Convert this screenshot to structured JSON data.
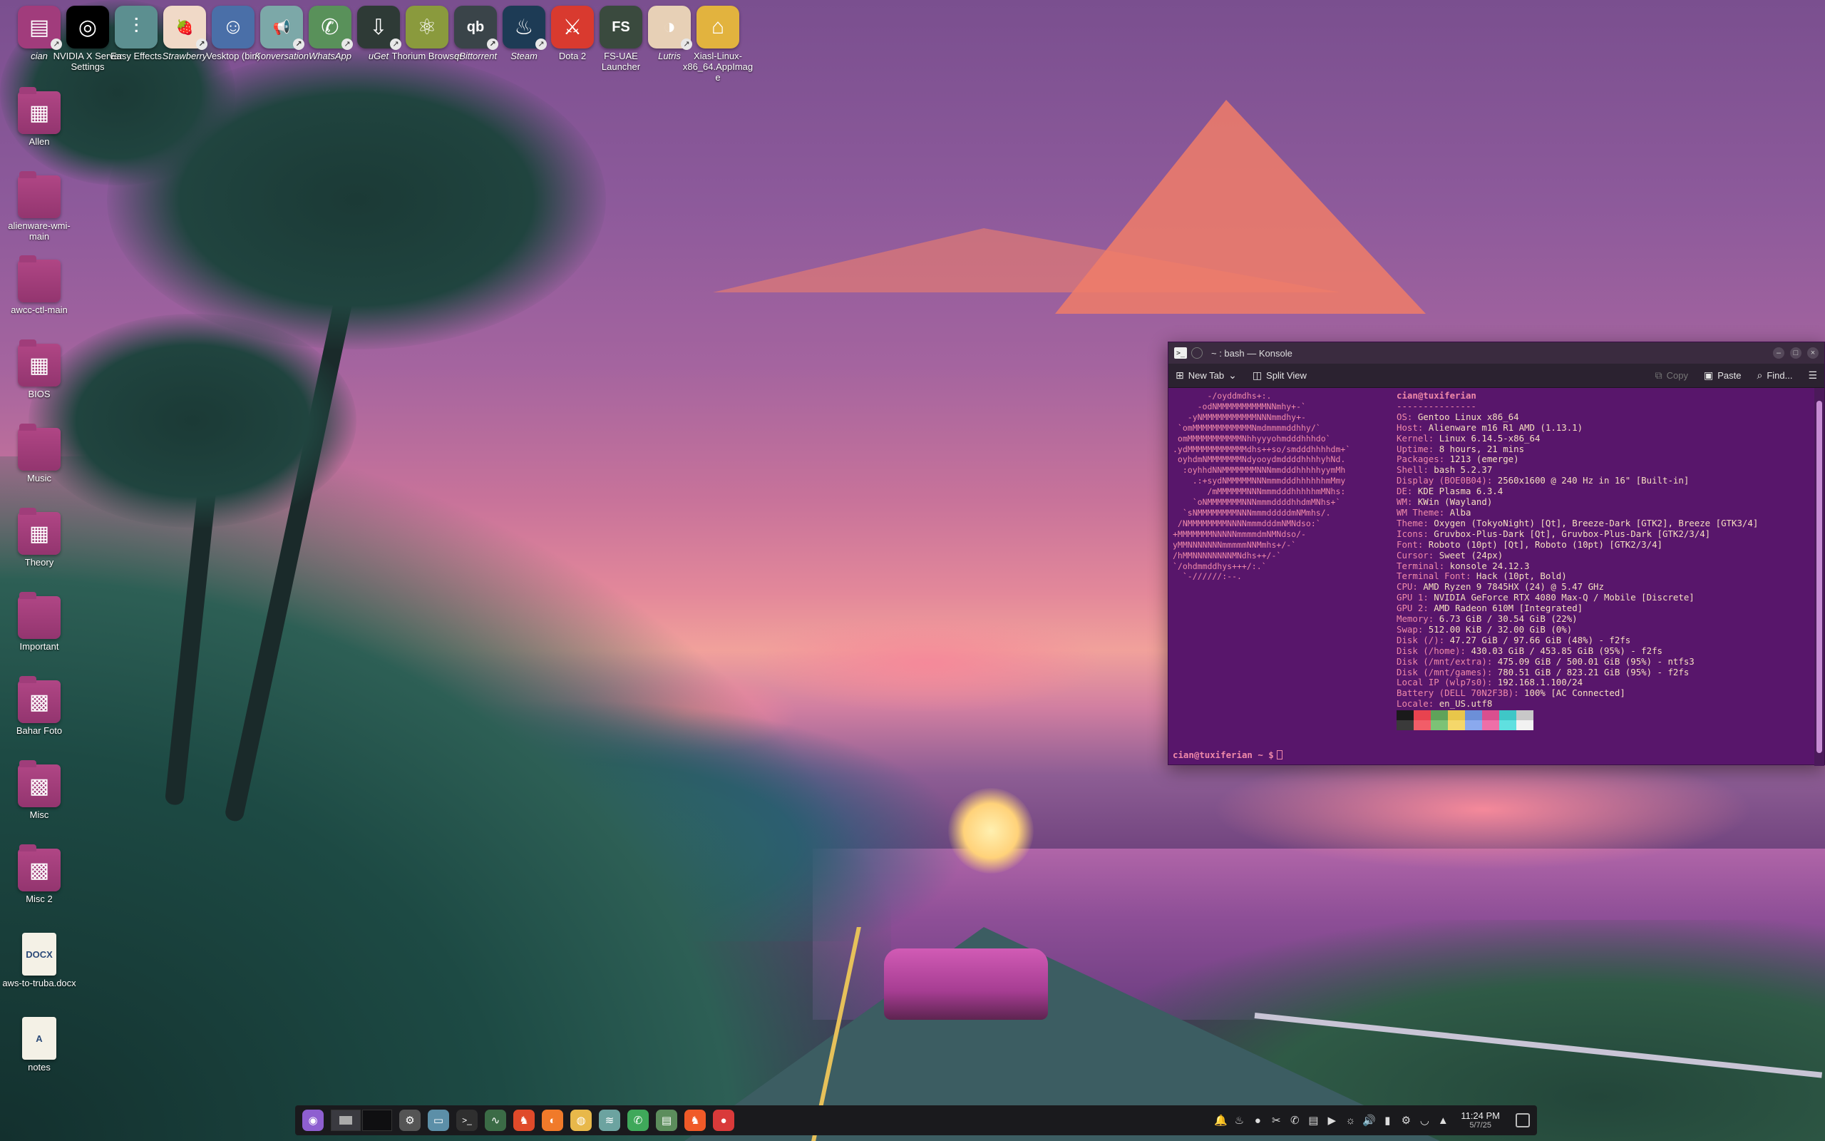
{
  "colors": {
    "folder": "#a13c7c",
    "terminal_bg": "#58166b",
    "terminal_pink": "#f08aa9",
    "terminal_cream": "#f7e0c0",
    "taskbar_bg": "#1a1a1d"
  },
  "desktop_top_icons": [
    {
      "label": "cian",
      "icon": "folder-user-icon",
      "glyph": "▤",
      "bg": "#a13c7c",
      "link": true,
      "italic": true
    },
    {
      "label": "NVIDIA X Server Settings",
      "icon": "nvidia-icon",
      "glyph": "◎",
      "bg": "#000000",
      "link": false,
      "italic": false
    },
    {
      "label": "Easy Effects",
      "icon": "equalizer-icon",
      "glyph": "⫶",
      "bg": "#5c8f90",
      "link": false,
      "italic": false
    },
    {
      "label": "Strawberry",
      "icon": "strawberry-icon",
      "glyph": "🍓",
      "bg": "#f0d9c7",
      "link": true,
      "italic": true
    },
    {
      "label": "Vesktop (bin)",
      "icon": "discord-icon",
      "glyph": "☺",
      "bg": "#4a6fa8",
      "link": false,
      "italic": false
    },
    {
      "label": "Konversation",
      "icon": "megaphone-icon",
      "glyph": "📢",
      "bg": "#7ca8a8",
      "link": true,
      "italic": true
    },
    {
      "label": "WhatsApp",
      "icon": "whatsapp-icon",
      "glyph": "✆",
      "bg": "#59915a",
      "link": true,
      "italic": true
    },
    {
      "label": "uGet",
      "icon": "uget-icon",
      "glyph": "⇩",
      "bg": "#2e3a36",
      "link": true,
      "italic": true
    },
    {
      "label": "Thorium Browser",
      "icon": "thorium-icon",
      "glyph": "⚛",
      "bg": "#8a9a3d",
      "link": false,
      "italic": false
    },
    {
      "label": "qBittorrent",
      "icon": "qbittorrent-icon",
      "glyph": "qb",
      "bg": "#3a4449",
      "link": true,
      "italic": true
    },
    {
      "label": "Steam",
      "icon": "steam-icon",
      "glyph": "♨",
      "bg": "#1d3b55",
      "link": true,
      "italic": true
    },
    {
      "label": "Dota 2",
      "icon": "dota2-icon",
      "glyph": "⚔",
      "bg": "#d93a2f",
      "link": false,
      "italic": false
    },
    {
      "label": "FS-UAE Launcher",
      "icon": "fsuae-icon",
      "glyph": "FS",
      "bg": "#3a4a3e",
      "link": false,
      "italic": false
    },
    {
      "label": "Lutris",
      "icon": "lutris-icon",
      "glyph": "◑",
      "bg": "#e7d0b6",
      "link": true,
      "italic": true
    },
    {
      "label": "Xiasl-Linux-x86_64.AppImage",
      "icon": "appimage-icon",
      "glyph": "⌂",
      "bg": "#e2b33e",
      "link": false,
      "italic": false
    }
  ],
  "desktop_left_icons": [
    {
      "label": "Allen",
      "icon": "folder-preview-icon",
      "glyph": "▦",
      "type": "folder"
    },
    {
      "label": "alienware-wmi-main",
      "icon": "folder-icon",
      "glyph": "",
      "type": "folder"
    },
    {
      "label": "awcc-ctl-main",
      "icon": "folder-icon",
      "glyph": "",
      "type": "folder"
    },
    {
      "label": "BIOS",
      "icon": "folder-preview-icon",
      "glyph": "▦",
      "type": "folder"
    },
    {
      "label": "Music",
      "icon": "folder-icon",
      "glyph": "",
      "type": "folder"
    },
    {
      "label": "Theory",
      "icon": "folder-preview-icon",
      "glyph": "▦",
      "type": "folder"
    },
    {
      "label": "Important",
      "icon": "folder-icon",
      "glyph": "",
      "type": "folder"
    },
    {
      "label": "Bahar Foto",
      "icon": "folder-photo-icon",
      "glyph": "▩",
      "type": "folder"
    },
    {
      "label": "Misc",
      "icon": "folder-photo-icon",
      "glyph": "▩",
      "type": "folder"
    },
    {
      "label": "Misc 2",
      "icon": "folder-photo-icon",
      "glyph": "▩",
      "type": "folder"
    },
    {
      "label": "aws-to-truba.docx",
      "icon": "docx-file-icon",
      "glyph": "DOCX",
      "type": "doc"
    },
    {
      "label": "notes",
      "icon": "text-file-icon",
      "glyph": "A",
      "type": "doc"
    }
  ],
  "konsole": {
    "title": "~ : bash — Konsole",
    "toolbar": {
      "new_tab": "New Tab",
      "split_view": "Split View",
      "copy": "Copy",
      "paste": "Paste",
      "find": "Find..."
    },
    "ascii_art": "       -/oyddmdhs+:.\n     -odNMMMMMMMMMMNNmhy+-`\n   -yNMMMMMMMMMMMNNNmmdhy+-\n `omMMMMMMMMMMMMNmdmmmmddhhy/`\n omMMMMMMMMMMMNhhyyyohmdddhhhdo`\n.ydMMMMMMMMMMMMdhs++so/smdddhhhhdm+`\n oyhdmNMMMMMMMNdyooydmddddhhhhyhNd.\n  :oyhhdNNMMMMMMMNNNmmdddhhhhhyymMh\n    .:+sydNMMMMMNNNmmmdddhhhhhhmMmy\n       /mMMMMMMNNNmmmdddhhhhhmMNhs:\n    `oNMMMMMMMNNNmmmddddhhdmMNhs+`\n  `sNMMMMMMMMNNNmmmdddddmNMmhs/.\n /NMMMMMMMMNNNNmmmdddmNMNdso:`\n+MMMMMMMNNNNNmmmmdmNMNdso/-\nyMMNNNNNNNmmmmmNNMmhs+/-`\n/hMMNNNNNNNNMNdhs++/-`\n`/ohdmmddhys+++/:.`\n  `-//////:--.",
    "user_host": "cian@tuxiferian",
    "separator": "---------------",
    "info": [
      {
        "key": "OS",
        "value": "Gentoo Linux x86_64"
      },
      {
        "key": "Host",
        "value": "Alienware m16 R1 AMD (1.13.1)"
      },
      {
        "key": "Kernel",
        "value": "Linux 6.14.5-x86_64"
      },
      {
        "key": "Uptime",
        "value": "8 hours, 21 mins"
      },
      {
        "key": "Packages",
        "value": "1213 (emerge)"
      },
      {
        "key": "Shell",
        "value": "bash 5.2.37"
      },
      {
        "key": "Display (BOE0B04)",
        "value": "2560x1600 @ 240 Hz in 16\" [Built-in]"
      },
      {
        "key": "DE",
        "value": "KDE Plasma 6.3.4"
      },
      {
        "key": "WM",
        "value": "KWin (Wayland)"
      },
      {
        "key": "WM Theme",
        "value": "Alba"
      },
      {
        "key": "Theme",
        "value": "Oxygen (TokyoNight) [Qt], Breeze-Dark [GTK2], Breeze [GTK3/4]"
      },
      {
        "key": "Icons",
        "value": "Gruvbox-Plus-Dark [Qt], Gruvbox-Plus-Dark [GTK2/3/4]"
      },
      {
        "key": "Font",
        "value": "Roboto (10pt) [Qt], Roboto (10pt) [GTK2/3/4]"
      },
      {
        "key": "Cursor",
        "value": "Sweet (24px)"
      },
      {
        "key": "Terminal",
        "value": "konsole 24.12.3"
      },
      {
        "key": "Terminal Font",
        "value": "Hack (10pt, Bold)"
      },
      {
        "key": "CPU",
        "value": "AMD Ryzen 9 7845HX (24) @ 5.47 GHz"
      },
      {
        "key": "GPU 1",
        "value": "NVIDIA GeForce RTX 4080 Max-Q / Mobile [Discrete]"
      },
      {
        "key": "GPU 2",
        "value": "AMD Radeon 610M [Integrated]"
      },
      {
        "key": "Memory",
        "value": "6.73 GiB / 30.54 GiB (22%)"
      },
      {
        "key": "Swap",
        "value": "512.00 KiB / 32.00 GiB (0%)"
      },
      {
        "key": "Disk (/)",
        "value": "47.27 GiB / 97.66 GiB (48%) - f2fs"
      },
      {
        "key": "Disk (/home)",
        "value": "430.03 GiB / 453.85 GiB (95%) - f2fs"
      },
      {
        "key": "Disk (/mnt/extra)",
        "value": "475.09 GiB / 500.01 GiB (95%) - ntfs3"
      },
      {
        "key": "Disk (/mnt/games)",
        "value": "780.51 GiB / 823.21 GiB (95%) - f2fs"
      },
      {
        "key": "Local IP (wlp7s0)",
        "value": "192.168.1.100/24"
      },
      {
        "key": "Battery (DELL 70N2F3B)",
        "value": "100% [AC Connected]"
      },
      {
        "key": "Locale",
        "value": "en_US.utf8"
      }
    ],
    "palette": [
      "#1a1a1a",
      "#e8434f",
      "#5fa35a",
      "#e8c64a",
      "#6c8fd8",
      "#d94f8f",
      "#3fc7c7",
      "#c8c8c8",
      "#3a3a3a",
      "#f25d68",
      "#7cc276",
      "#f5d76a",
      "#8aa9ee",
      "#ee6fa8",
      "#5fe0e0",
      "#f2f2f2"
    ],
    "prompt": "cian@tuxiferian ~ $"
  },
  "taskbar": {
    "apps": [
      {
        "icon": "app-launcher-icon",
        "glyph": "◉",
        "bg": "#8e5fd0"
      },
      {
        "icon": "settings-icon",
        "glyph": "⚙",
        "bg": "#555555"
      },
      {
        "icon": "file-manager-icon",
        "glyph": "▭",
        "bg": "#5c8fa8"
      },
      {
        "icon": "terminal-icon",
        "glyph": ">_",
        "bg": "#2f2f2f"
      },
      {
        "icon": "system-monitor-icon",
        "glyph": "∿",
        "bg": "#3b6b46"
      },
      {
        "icon": "brave-icon",
        "glyph": "♞",
        "bg": "#e04a2a"
      },
      {
        "icon": "firefox-icon",
        "glyph": "◐",
        "bg": "#f07a2a"
      },
      {
        "icon": "chrome-icon",
        "glyph": "◍",
        "bg": "#e8b84a"
      },
      {
        "icon": "dolphin-icon",
        "glyph": "≋",
        "bg": "#6ca3a0"
      },
      {
        "icon": "whatsapp-icon",
        "glyph": "✆",
        "bg": "#3fa85a"
      },
      {
        "icon": "libreoffice-icon",
        "glyph": "▤",
        "bg": "#5c8d5c"
      },
      {
        "icon": "brave-icon",
        "glyph": "♞",
        "bg": "#f05a28"
      },
      {
        "icon": "strawberry-icon",
        "glyph": "●",
        "bg": "#d93a3a"
      }
    ],
    "tray": [
      {
        "icon": "notification-icon",
        "glyph": "🔔"
      },
      {
        "icon": "steam-tray-icon",
        "glyph": "♨"
      },
      {
        "icon": "strawberry-tray-icon",
        "glyph": "●"
      },
      {
        "icon": "tools-icon",
        "glyph": "✂"
      },
      {
        "icon": "whatsapp-tray-icon",
        "glyph": "✆"
      },
      {
        "icon": "clipboard-icon",
        "glyph": "▤"
      },
      {
        "icon": "media-play-icon",
        "glyph": "▶"
      },
      {
        "icon": "brightness-icon",
        "glyph": "☼"
      },
      {
        "icon": "volume-icon",
        "glyph": "🔊"
      },
      {
        "icon": "battery-icon",
        "glyph": "▮"
      },
      {
        "icon": "gear-icon",
        "glyph": "⚙"
      },
      {
        "icon": "wifi-icon",
        "glyph": "◡"
      },
      {
        "icon": "expand-tray-icon",
        "glyph": "▲"
      }
    ],
    "clock": {
      "time": "11:24 PM",
      "date": "5/7/25"
    }
  }
}
